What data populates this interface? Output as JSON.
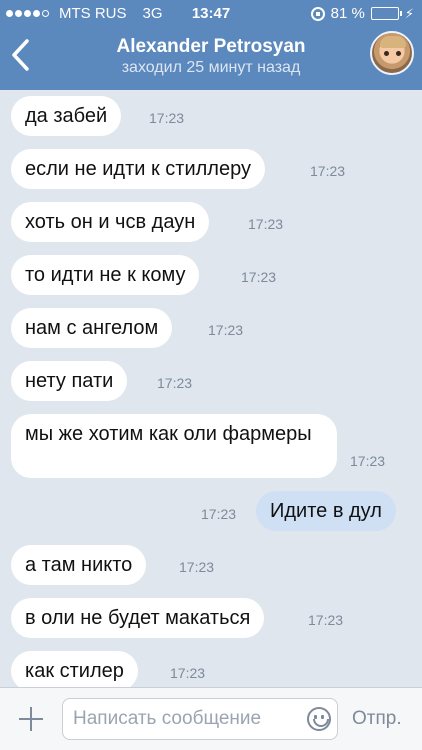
{
  "status_bar": {
    "carrier": "MTS RUS",
    "network": "3G",
    "time": "13:47",
    "battery_percent": "81 %",
    "battery_level": 0.81,
    "icons": [
      "signal-dots-icon",
      "rotation-lock-icon",
      "battery-icon",
      "charging-bolt-icon"
    ]
  },
  "header": {
    "title": "Alexander Petrosyan",
    "subtitle": "заходил 25 минут назад",
    "back_icon": "chevron-left-icon"
  },
  "messages": [
    {
      "direction": "in",
      "text": "да забей",
      "time": "17:23"
    },
    {
      "direction": "in",
      "text": "если не идти к стиллеру",
      "time": "17:23"
    },
    {
      "direction": "in",
      "text": "хоть он и чсв даун",
      "time": "17:23"
    },
    {
      "direction": "in",
      "text": "то идти не к кому",
      "time": "17:23"
    },
    {
      "direction": "in",
      "text": "нам с ангелом",
      "time": "17:23"
    },
    {
      "direction": "in",
      "text": "нету пати",
      "time": "17:23"
    },
    {
      "direction": "in",
      "text": "мы же хотим как оли фармеры",
      "time": "17:23"
    },
    {
      "direction": "out",
      "text": "Идите в дул",
      "time": "17:23"
    },
    {
      "direction": "in",
      "text": "а там никто",
      "time": "17:23"
    },
    {
      "direction": "in",
      "text": "в оли не будет макаться",
      "time": "17:23"
    },
    {
      "direction": "in",
      "text": "как стилер",
      "time": "17:23"
    }
  ],
  "input": {
    "placeholder": "Написать сообщение",
    "value": "",
    "send_label": "Отпр.",
    "attach_icon": "plus-icon",
    "emoji_icon": "smiley-icon"
  },
  "colors": {
    "header_bg": "#5b88bd",
    "chat_bg": "#dfe6ee",
    "incoming_bubble": "#ffffff",
    "outgoing_bubble": "#cfe0f5",
    "battery_fill": "#5fe05b"
  }
}
